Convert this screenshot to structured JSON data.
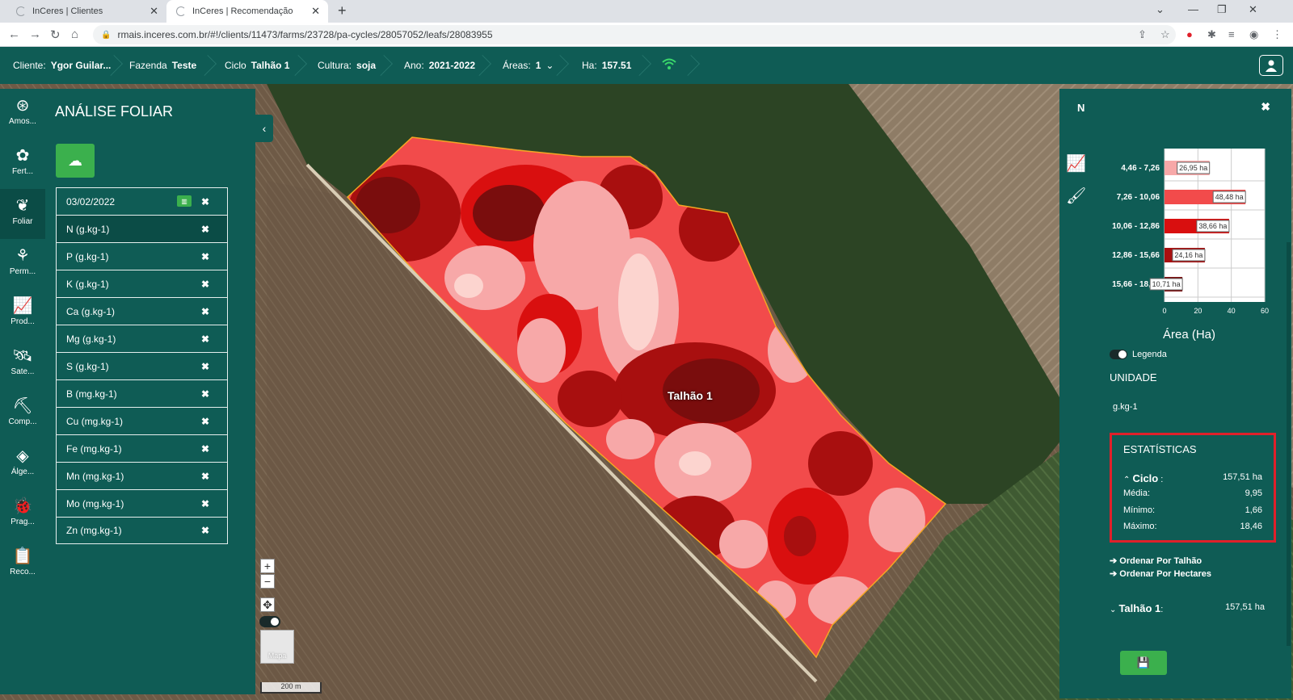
{
  "browser": {
    "tabs": [
      {
        "title": "InCeres | Clientes"
      },
      {
        "title": "InCeres | Recomendação"
      }
    ],
    "url": "rmais.inceres.com.br/#!/clients/11473/farms/23728/pa-cycles/28057052/leafs/28083955"
  },
  "header": {
    "cliente_label": "Cliente:",
    "cliente_value": "Ygor Guilar...",
    "fazenda_label": "Fazenda",
    "fazenda_value": "Teste",
    "ciclo_label": "Ciclo",
    "ciclo_value": "Talhão 1",
    "cultura_label": "Cultura:",
    "cultura_value": "soja",
    "ano_label": "Ano:",
    "ano_value": "2021-2022",
    "areas_label": "Áreas:",
    "areas_value": "1",
    "ha_label": "Ha:",
    "ha_value": "157.51"
  },
  "rail": [
    {
      "label": "Amos..."
    },
    {
      "label": "Fert..."
    },
    {
      "label": "Foliar"
    },
    {
      "label": "Perm..."
    },
    {
      "label": "Prod..."
    },
    {
      "label": "Sate..."
    },
    {
      "label": "Comp..."
    },
    {
      "label": "Álge..."
    },
    {
      "label": "Prag..."
    },
    {
      "label": "Reco..."
    }
  ],
  "left_panel": {
    "title": "ANÁLISE FOLIAR",
    "date": "03/02/2022",
    "items": [
      {
        "label": "N (g.kg-1)"
      },
      {
        "label": "P (g.kg-1)"
      },
      {
        "label": "K (g.kg-1)"
      },
      {
        "label": "Ca (g.kg-1)"
      },
      {
        "label": "Mg (g.kg-1)"
      },
      {
        "label": "S (g.kg-1)"
      },
      {
        "label": "B (mg.kg-1)"
      },
      {
        "label": "Cu (mg.kg-1)"
      },
      {
        "label": "Fe (mg.kg-1)"
      },
      {
        "label": "Mn (mg.kg-1)"
      },
      {
        "label": "Mo (mg.kg-1)"
      },
      {
        "label": "Zn (mg.kg-1)"
      }
    ]
  },
  "map": {
    "field_label": "Talhão 1",
    "minimap_label": "Mapa",
    "scale_label": "200 m",
    "zoom_in": "+",
    "zoom_out": "−"
  },
  "right_panel": {
    "title": "N",
    "xlabel": "Área (Ha)",
    "legend_toggle": "Legenda",
    "unit_title": "UNIDADE",
    "unit_value": "g.kg-1",
    "stats_title": "ESTATÍSTICAS",
    "ciclo_label": "Ciclo",
    "ciclo_value": "157,51 ha",
    "media_label": "Média:",
    "media_value": "9,95",
    "min_label": "Mínimo:",
    "min_value": "1,66",
    "max_label": "Máximo:",
    "max_value": "18,46",
    "sort_talhao": "Ordenar Por Talhão",
    "sort_hectares": "Ordenar Por Hectares",
    "talhao_label": "Talhão 1",
    "talhao_value": "157,51 ha"
  },
  "chart_data": {
    "type": "bar",
    "orientation": "horizontal",
    "categories": [
      "4,46 - 7,26",
      "7,26 - 10,06",
      "10,06 - 12,86",
      "12,86 - 15,66",
      "15,66 - 18,46"
    ],
    "values": [
      26.95,
      48.48,
      38.66,
      24.16,
      10.71
    ],
    "data_labels": [
      "26,95 ha",
      "48,48 ha",
      "38,66 ha",
      "24,16 ha",
      "10,71 ha"
    ],
    "colors": [
      "#f7a8a8",
      "#f24b4b",
      "#d90f0f",
      "#a80f0f",
      "#7a0d0d"
    ],
    "xlabel": "Área (Ha)",
    "xlim": [
      0,
      60
    ],
    "xticks": [
      "0",
      "20",
      "40",
      "60"
    ]
  }
}
